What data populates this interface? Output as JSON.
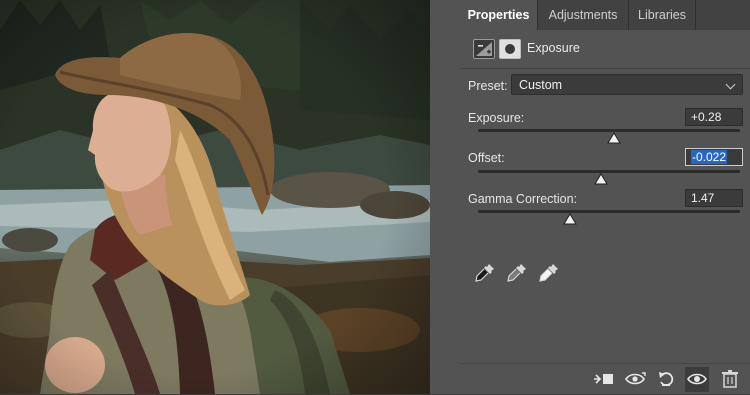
{
  "tabs": [
    {
      "label": "Properties",
      "active": true
    },
    {
      "label": "Adjustments",
      "active": false
    },
    {
      "label": "Libraries",
      "active": false
    }
  ],
  "adjustment": {
    "title": "Exposure",
    "icons": [
      "exposure-adjustment-icon",
      "layer-mask-icon"
    ]
  },
  "preset": {
    "label": "Preset:",
    "value": "Custom"
  },
  "sliders": [
    {
      "label": "Exposure:",
      "value": "+0.28",
      "position": 0.52,
      "focused": false
    },
    {
      "label": "Offset:",
      "value": "-0.022",
      "position": 0.47,
      "focused": true
    },
    {
      "label": "Gamma Correction:",
      "value": "1.47",
      "position": 0.35,
      "focused": false
    }
  ],
  "eyedroppers": [
    "black-point-eyedropper-icon",
    "gray-point-eyedropper-icon",
    "white-point-eyedropper-icon"
  ],
  "bottom_toolbar": [
    "clip-to-layer-icon",
    "view-previous-state-icon",
    "reset-icon",
    "toggle-visibility-icon",
    "delete-icon"
  ],
  "colors": {
    "panel_bg": "#535353",
    "tab_bar_bg": "#424242",
    "field_bg": "#3b3b3b",
    "selection": "#2866c4"
  }
}
